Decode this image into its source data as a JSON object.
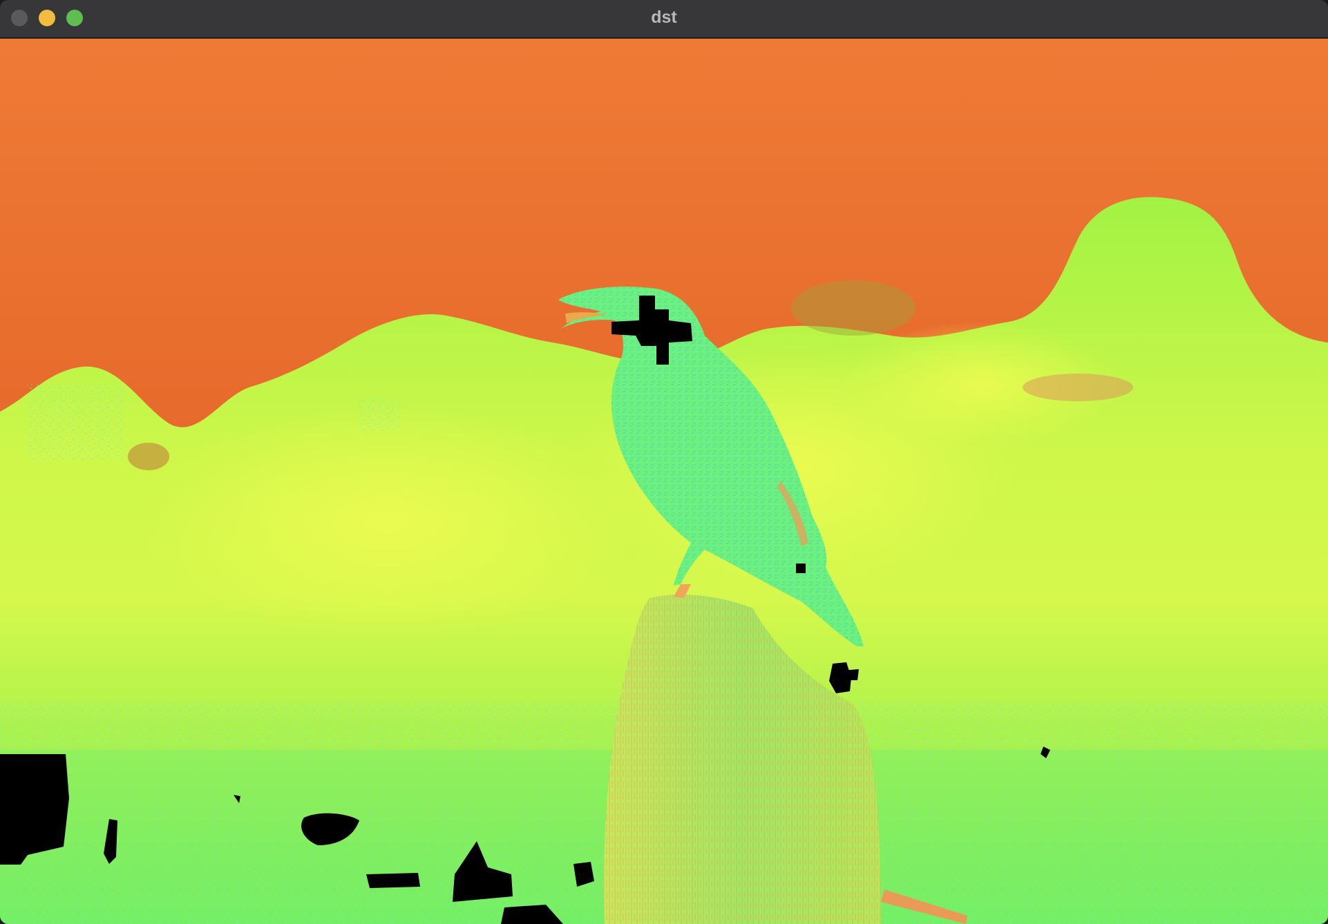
{
  "window": {
    "title": "dst"
  },
  "image": {
    "subject": "bird-on-post",
    "colormap": [
      "#ef7a36",
      "#dc5a22",
      "#9ef544",
      "#e2f84e",
      "#6ef278",
      "#5ef5d8",
      "#000000"
    ]
  }
}
